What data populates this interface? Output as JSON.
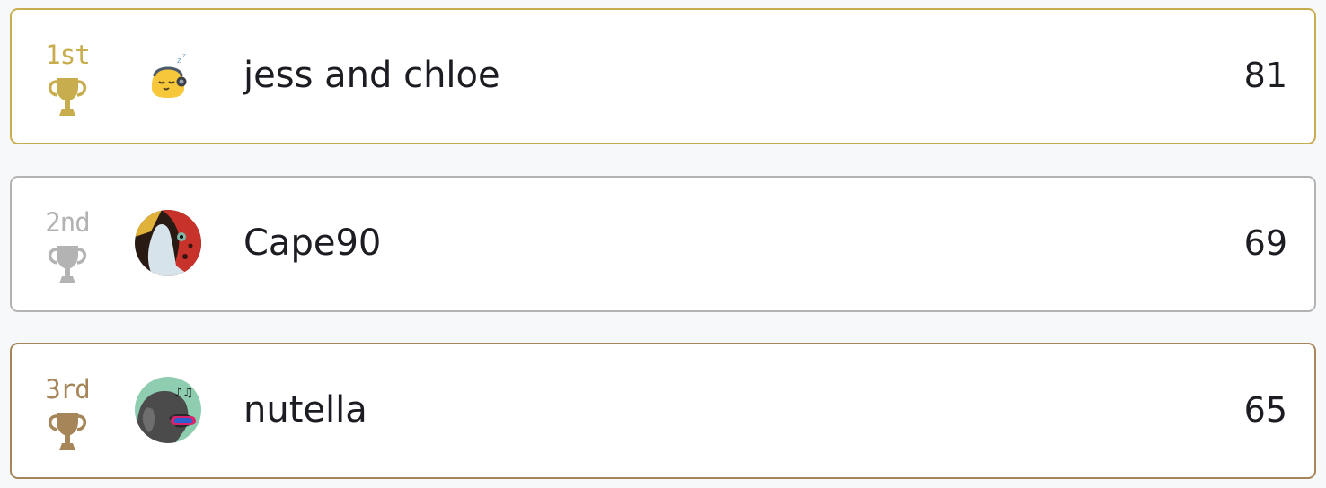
{
  "leaderboard": [
    {
      "rank": "1st",
      "name": "jess and chloe",
      "score": "81",
      "accent": "#c8ad4e",
      "avatar_icon": "sleepy-headphones-emoji-icon"
    },
    {
      "rank": "2nd",
      "name": "Cape90",
      "score": "69",
      "accent": "#b3b3b3",
      "avatar_icon": "red-bird-photo-avatar"
    },
    {
      "rank": "3rd",
      "name": "nutella",
      "score": "65",
      "accent": "#a68659",
      "avatar_icon": "elephant-music-avatar"
    }
  ]
}
